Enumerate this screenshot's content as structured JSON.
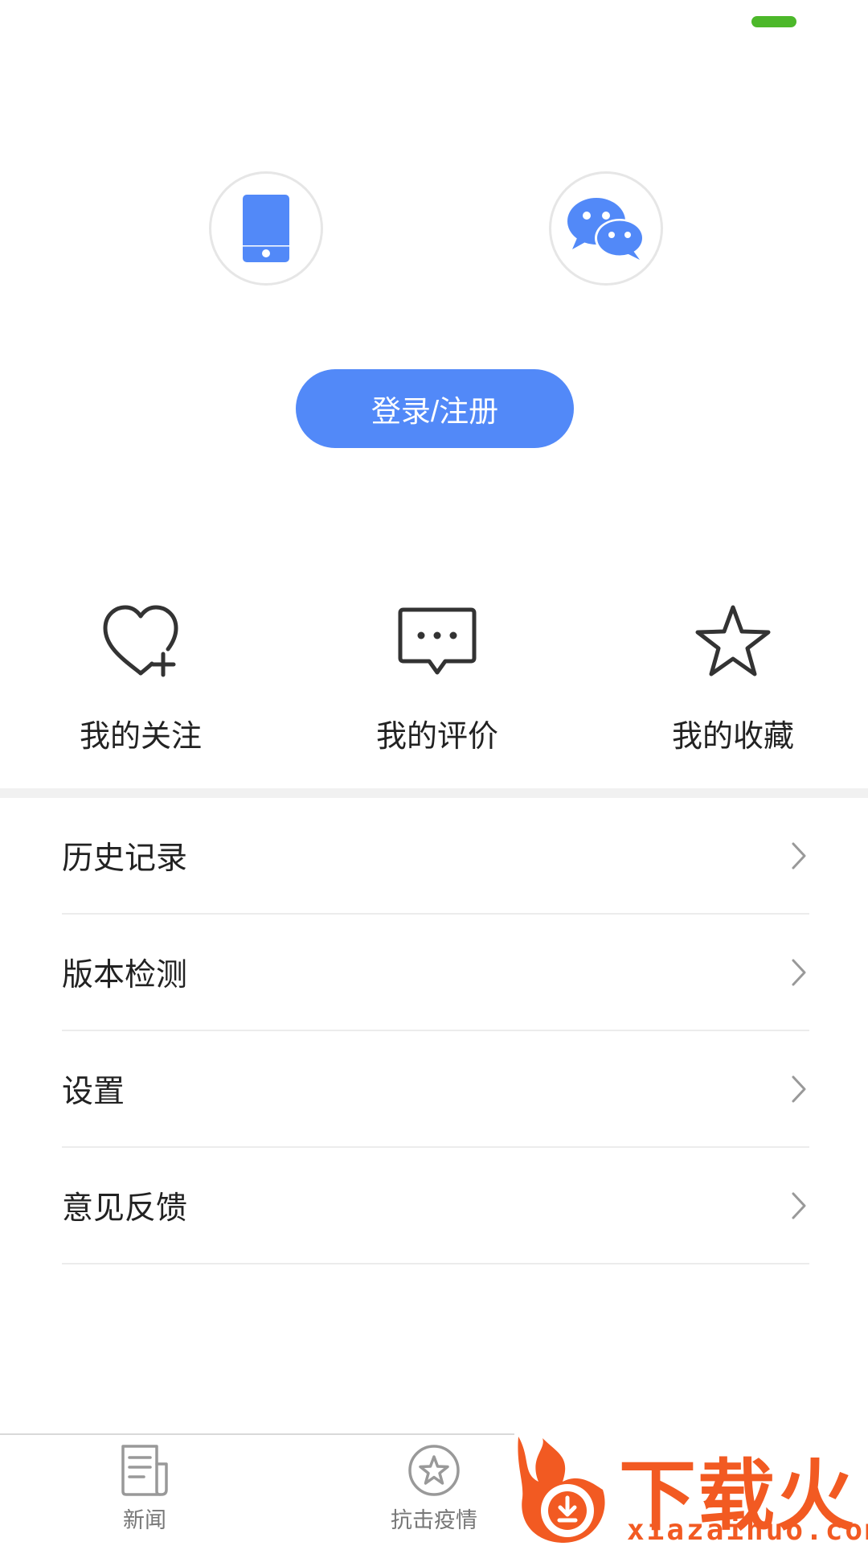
{
  "login": {
    "phone_icon": "phone-icon",
    "wechat_icon": "wechat-icon",
    "button_label": "登录/注册"
  },
  "shortcuts": [
    {
      "label": "我的关注",
      "icon": "heart-plus-icon"
    },
    {
      "label": "我的评价",
      "icon": "comment-icon"
    },
    {
      "label": "我的收藏",
      "icon": "star-icon"
    }
  ],
  "menu": [
    {
      "label": "历史记录"
    },
    {
      "label": "版本检测"
    },
    {
      "label": "设置"
    },
    {
      "label": "意见反馈"
    }
  ],
  "tabbar": {
    "tabs": [
      {
        "label": "新闻",
        "icon": "news-icon"
      },
      {
        "label": "抗击疫情",
        "icon": "star-circle-icon"
      }
    ]
  },
  "watermark": {
    "brand": "下载火",
    "url": "xiazaihuo.com"
  },
  "colors": {
    "accent": "#5289f8",
    "status_green": "#4cb82a",
    "watermark_orange": "#f25a22"
  }
}
